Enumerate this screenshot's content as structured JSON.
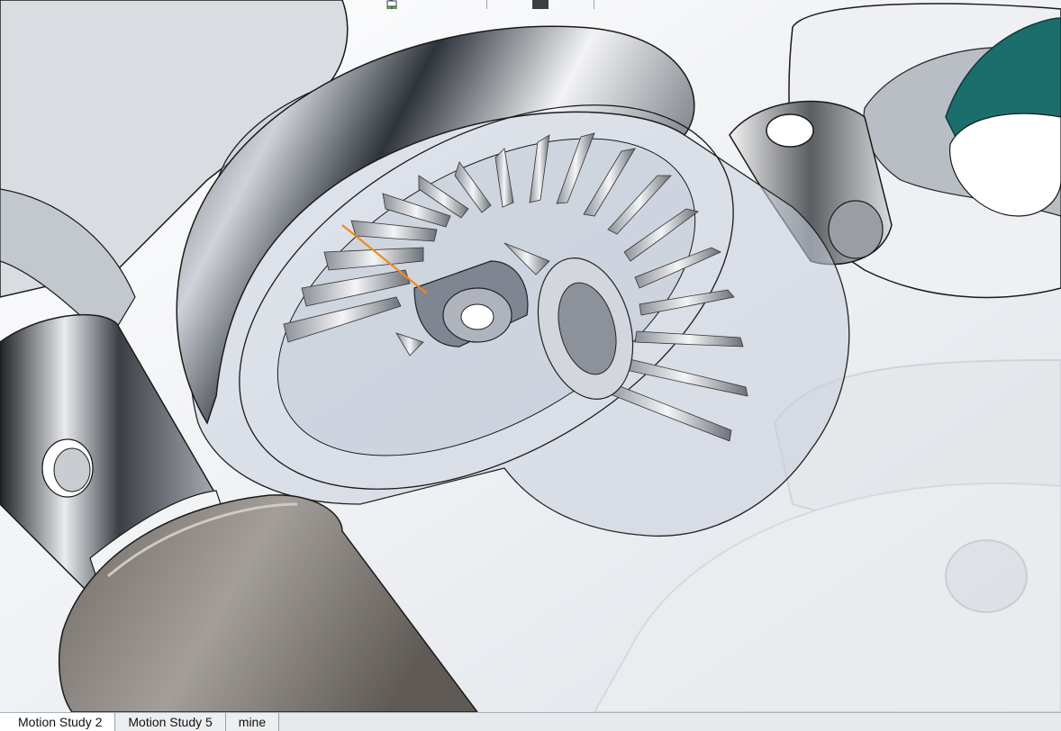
{
  "app": {
    "context": "3D CAD graphics area - bevel gear differential assembly"
  },
  "toolbar": {
    "icons": [
      "zoom-to-fit-icon",
      "zoom-to-area-icon",
      "previous-view-icon",
      "section-view-icon",
      "dynamic-annotation-icon",
      "view-orientation-icon",
      "display-style-icon",
      "hide-show-items-icon",
      "edit-appearance-icon",
      "apply-scene-icon",
      "view-settings-icon"
    ]
  },
  "tabs": [
    {
      "label": "Motion Study 2"
    },
    {
      "label": "Motion Study 5"
    },
    {
      "label": "mine"
    }
  ],
  "colors": {
    "metal_dark": "#2b2f35",
    "metal_light": "#e8eaee",
    "housing_transparent": "#c9cfdc",
    "accent_orange": "#f08a1c",
    "teal_part": "#1b6e6c",
    "shaft_grey": "#8a8581"
  }
}
